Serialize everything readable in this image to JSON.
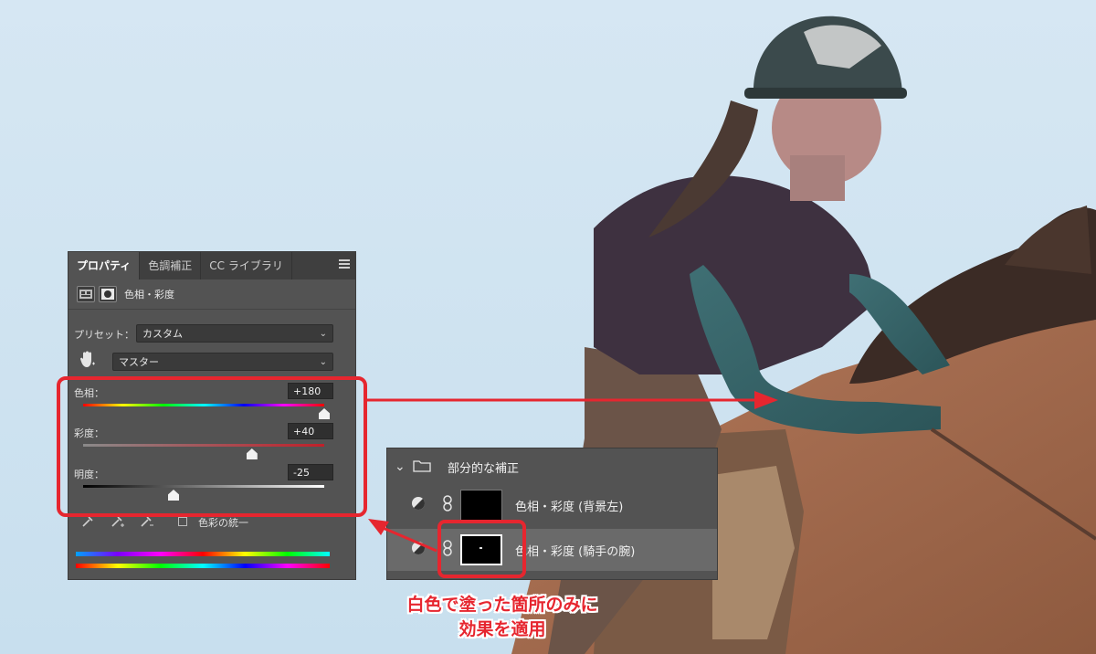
{
  "properties_panel": {
    "tabs": [
      {
        "label": "プロパティ",
        "active": true
      },
      {
        "label": "色調補正",
        "active": false
      },
      {
        "label": "CC ライブラリ",
        "active": false
      }
    ],
    "adjustment_title": "色相・彩度",
    "preset_label": "プリセット：",
    "preset_value": "カスタム",
    "channel_value": "マスター",
    "sliders": [
      {
        "label": "色相：",
        "value": "+180",
        "level": 1.0
      },
      {
        "label": "彩度：",
        "value": "+40",
        "level": 0.7
      },
      {
        "label": "明度：",
        "value": "-25",
        "level": 0.375
      }
    ],
    "colorize_label": "色彩の統一"
  },
  "layers_panel": {
    "group_label": "部分的な補正",
    "layers": [
      {
        "label": "色相・彩度 (背景左)",
        "selected": false
      },
      {
        "label": "色相・彩度 (騎手の腕)",
        "selected": true
      }
    ]
  },
  "annotation": {
    "caption_line1": "白色で塗った箇所のみに",
    "caption_line2": "効果を適用",
    "color": "#e6262f"
  }
}
